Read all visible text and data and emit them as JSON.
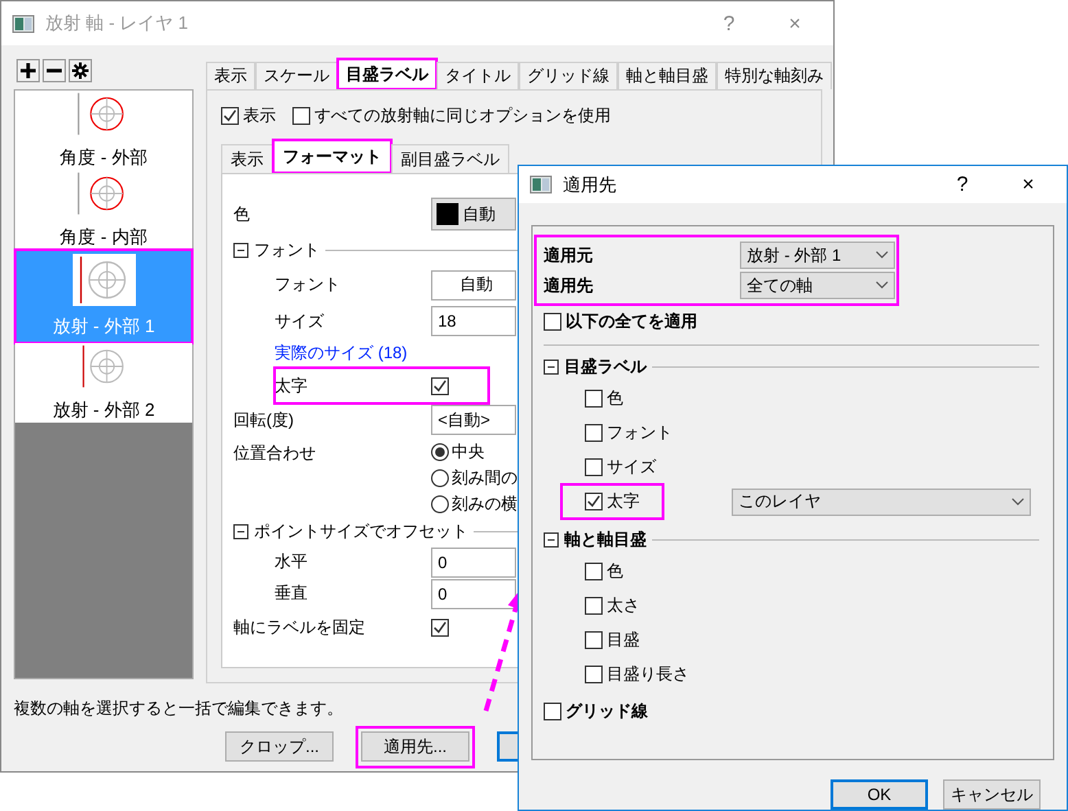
{
  "main_dialog": {
    "title": "放射 軸 - レイヤ 1",
    "help": "?",
    "close": "×",
    "axis_list": [
      {
        "label": "角度 - 外部",
        "kind": "angular",
        "selected": false
      },
      {
        "label": "角度 - 内部",
        "kind": "angular",
        "selected": false
      },
      {
        "label": "放射 - 外部 1",
        "kind": "radial",
        "selected": true,
        "highlighted": true
      },
      {
        "label": "放射 - 外部 2",
        "kind": "radial",
        "selected": false
      }
    ],
    "tabs": [
      {
        "label": "表示",
        "selected": false
      },
      {
        "label": "スケール",
        "selected": false
      },
      {
        "label": "目盛ラベル",
        "selected": true,
        "highlighted": true
      },
      {
        "label": "タイトル",
        "selected": false
      },
      {
        "label": "グリッド線",
        "selected": false
      },
      {
        "label": "軸と軸目盛",
        "selected": false
      },
      {
        "label": "特別な軸刻み",
        "selected": false
      }
    ],
    "options": [
      {
        "label": "表示",
        "checked": true
      },
      {
        "label": "すべての放射軸に同じオプションを使用",
        "checked": false
      }
    ],
    "sub_tabs": [
      {
        "label": "表示",
        "selected": false
      },
      {
        "label": "フォーマット",
        "selected": true,
        "highlighted": true
      },
      {
        "label": "副目盛ラベル",
        "selected": false
      }
    ],
    "rows": [
      {
        "kind": "color",
        "label": "色",
        "value": "自動"
      },
      {
        "kind": "group",
        "label": "フォント",
        "expanded": true,
        "children": [
          {
            "kind": "button",
            "label": "フォント",
            "value": "自動"
          },
          {
            "kind": "dropdown",
            "label": "サイズ",
            "value": "18"
          },
          {
            "kind": "link",
            "label": "実際のサイズ (18)"
          },
          {
            "kind": "checkbox",
            "label": "太字",
            "checked": true,
            "highlighted": true
          }
        ]
      },
      {
        "kind": "dropdown",
        "label": "回転(度)",
        "value": "<自動>"
      },
      {
        "kind": "radio",
        "label": "位置合わせ",
        "options": [
          {
            "label": "中央",
            "selected": true
          },
          {
            "label": "刻み間の",
            "selected": false
          },
          {
            "label": "刻みの横",
            "selected": false
          }
        ]
      },
      {
        "kind": "group",
        "label": "ポイントサイズでオフセット",
        "expanded": true,
        "children": [
          {
            "kind": "field",
            "label": "水平",
            "value": "0"
          },
          {
            "kind": "field",
            "label": "垂直",
            "value": "0"
          }
        ]
      },
      {
        "kind": "checkbox",
        "label": "軸にラベルを固定",
        "checked": true
      }
    ],
    "hint": "複数の軸を選択すると一括で編集できます。",
    "buttons": [
      {
        "label": "クロップ...",
        "highlighted": false,
        "default": false
      },
      {
        "label": "適用先...",
        "highlighted": true,
        "default": false
      },
      {
        "default": true,
        "highlighted": false
      }
    ]
  },
  "apply_dialog": {
    "title": "適用先",
    "help": "?",
    "close": "×",
    "selectors_highlighted": true,
    "selectors": [
      {
        "label": "適用元",
        "value": "放射 - 外部 1"
      },
      {
        "label": "適用先",
        "value": "全ての軸"
      }
    ],
    "apply_all": {
      "label": "以下の全てを適用",
      "checked": false
    },
    "groups": [
      {
        "label": "目盛ラベル",
        "expanded": true,
        "children": [
          {
            "label": "色",
            "checked": false
          },
          {
            "label": "フォント",
            "checked": false
          },
          {
            "label": "サイズ",
            "checked": false
          },
          {
            "label": "太字",
            "checked": true,
            "highlighted": true,
            "scope": "このレイヤ"
          }
        ]
      },
      {
        "label": "軸と軸目盛",
        "expanded": true,
        "children": [
          {
            "label": "色",
            "checked": false
          },
          {
            "label": "太さ",
            "checked": false
          },
          {
            "label": "目盛",
            "checked": false
          },
          {
            "label": "目盛り長さ",
            "checked": false
          }
        ]
      }
    ],
    "grid": {
      "label": "グリッド線",
      "checked": false
    },
    "buttons": [
      {
        "label": "OK",
        "default": true
      },
      {
        "label": "キャンセル",
        "default": false
      }
    ]
  }
}
